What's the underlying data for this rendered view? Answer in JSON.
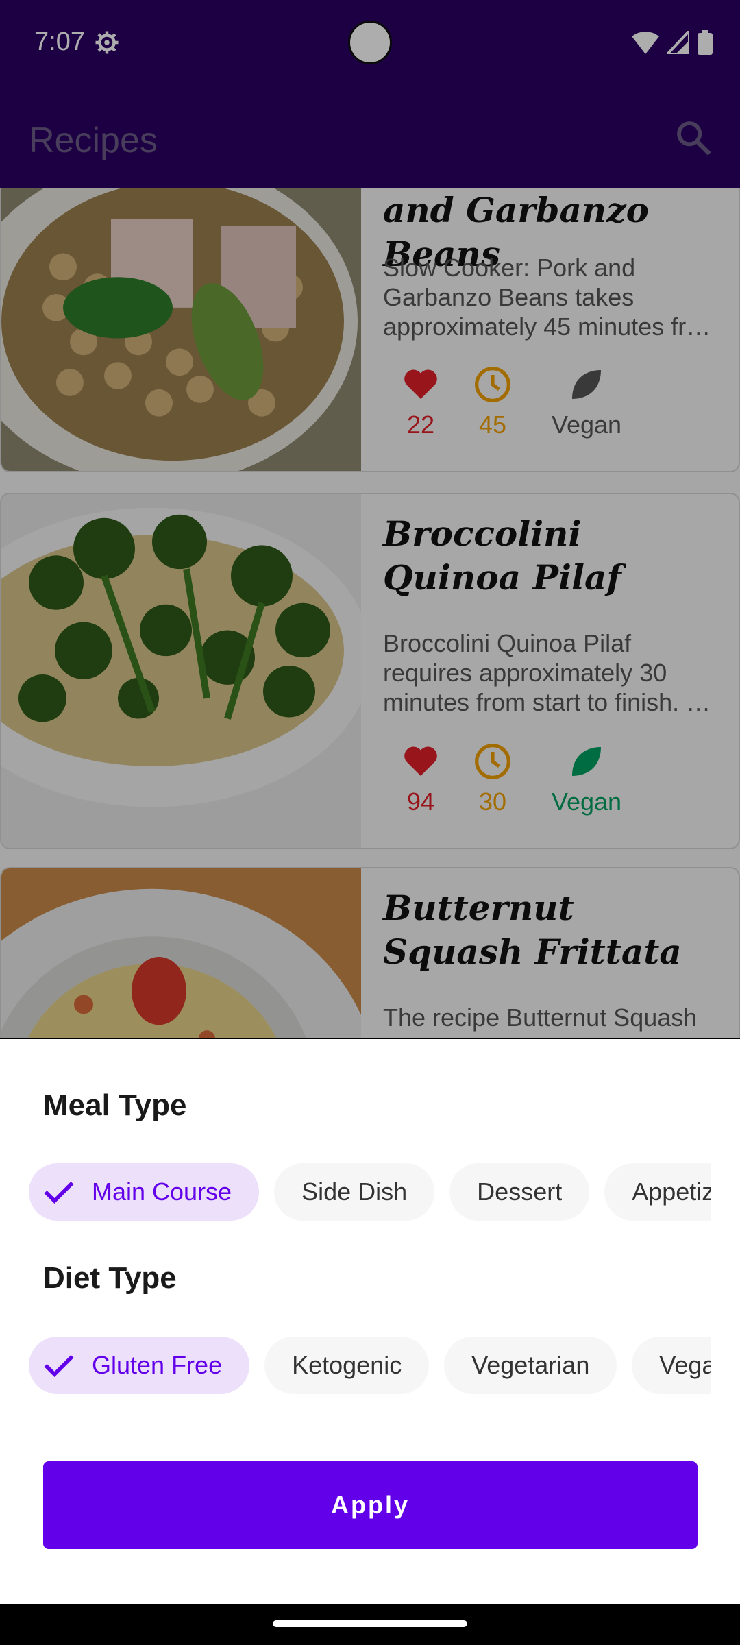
{
  "status_bar": {
    "time": "7:07"
  },
  "app_bar": {
    "title": "Recipes"
  },
  "recipes": [
    {
      "title": "and Garbanzo Beans",
      "description": "Slow Cooker: Pork and Garbanzo Beans takes approximately 45 minutes fr…",
      "likes": "22",
      "minutes": "45",
      "vegan_label": "Vegan",
      "vegan": false
    },
    {
      "title": "Broccolini Quinoa Pilaf",
      "description": "Broccolini Quinoa Pilaf requires approximately 30 minutes from start to finish. …",
      "likes": "94",
      "minutes": "30",
      "vegan_label": "Vegan",
      "vegan": true
    },
    {
      "title": "Butternut Squash Frittata",
      "description": "The recipe Butternut Squash"
    }
  ],
  "filter_sheet": {
    "meal_type": {
      "title": "Meal Type",
      "chips": [
        {
          "label": "Main Course",
          "selected": true
        },
        {
          "label": "Side Dish",
          "selected": false
        },
        {
          "label": "Dessert",
          "selected": false
        },
        {
          "label": "Appetizer",
          "selected": false
        }
      ]
    },
    "diet_type": {
      "title": "Diet Type",
      "chips": [
        {
          "label": "Gluten Free",
          "selected": true
        },
        {
          "label": "Ketogenic",
          "selected": false
        },
        {
          "label": "Vegetarian",
          "selected": false
        },
        {
          "label": "Vegan",
          "selected": false
        }
      ]
    },
    "apply_label": "Apply"
  },
  "colors": {
    "primary_dark": "#2a0063",
    "accent": "#6200ea",
    "heart": "#e0202a",
    "clock": "#f0a000",
    "vegan_active": "#00a060",
    "vegan_inactive": "#555555"
  }
}
